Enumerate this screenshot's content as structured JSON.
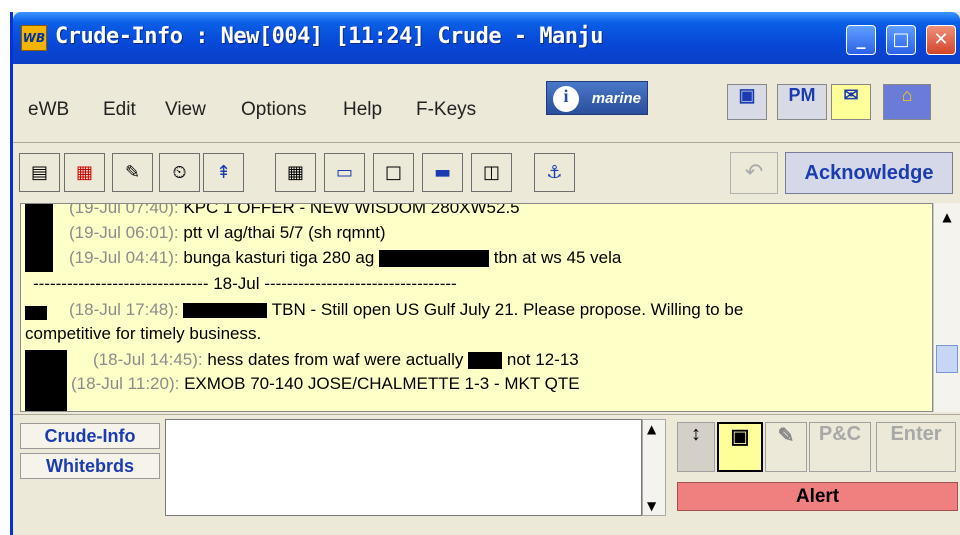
{
  "window": {
    "title": "Crude-Info : New[004] [11:24]  Crude - Manju",
    "app_icon_label": "WB"
  },
  "title_buttons": {
    "minimize": "_",
    "maximize": "□",
    "close": "✕"
  },
  "menu": [
    {
      "label": "eWB"
    },
    {
      "label": "Edit"
    },
    {
      "label": "View"
    },
    {
      "label": "Options"
    },
    {
      "label": "Help"
    },
    {
      "label": "F-Keys"
    }
  ],
  "logo": {
    "text": "marine",
    "mark": "i"
  },
  "right_buttons": {
    "pm_label": "PM"
  },
  "toolbar": {
    "acknowledge_label": "Acknowledge"
  },
  "messages": {
    "lines": [
      {
        "ts": "(19-Jul 07:40):",
        "text": "KPC 1 OFFER - NEW WISDOM 280XW52.5"
      },
      {
        "ts": "(19-Jul 06:01):",
        "text": "ptt  vl ag/thai 5/7 (sh rqmnt)"
      },
      {
        "ts": "(19-Jul 04:41):",
        "text_a": "bunga kasturi tiga 280 ag",
        "text_b": "tbn at ws 45 vela"
      },
      {
        "separator": "------------------------------- 18-Jul ----------------------------------"
      },
      {
        "ts": "(18-Jul 17:48):",
        "text": "TBN - Still open US Gulf July 21.  Please propose.  Willing to be"
      },
      {
        "text": "competitive for timely business."
      },
      {
        "ts": "(18-Jul 14:45):",
        "text_a": "hess dates from waf were actually",
        "text_b": "not 12-13"
      },
      {
        "ts": "(18-Jul 11:20):",
        "text": "EXMOB 70-140 JOSE/CHALMETTE 1-3 - MKT QTE"
      }
    ]
  },
  "tabs": [
    {
      "label": "Crude-Info"
    },
    {
      "label": "Whitebrds"
    }
  ],
  "bottom_buttons": {
    "pc_label": "P&C",
    "enter_label": "Enter",
    "alert_label": "Alert"
  },
  "colors": {
    "message_bg": "#ffffc8",
    "alert_bg": "#f08080",
    "title_blue": "#0848d8",
    "link_blue": "#1a3cb0"
  }
}
